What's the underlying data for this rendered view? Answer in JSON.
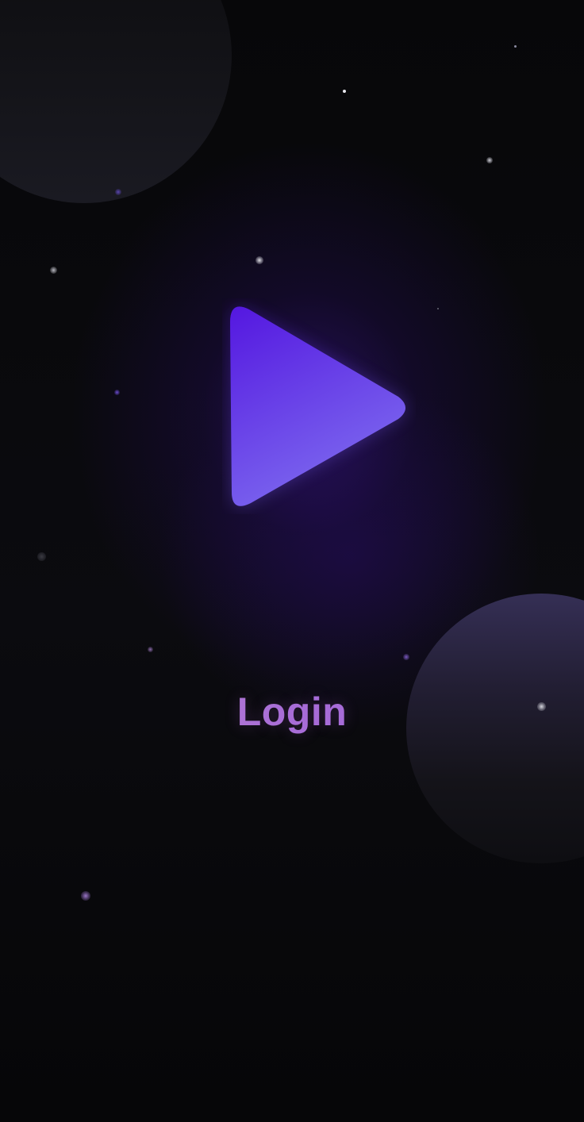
{
  "screen": {
    "background": "#050507"
  },
  "logo": {
    "icon": "play-icon",
    "gradient_start": "#5417e0",
    "gradient_end": "#7c68ef"
  },
  "login": {
    "label": "Login",
    "color_start": "#c48ec8",
    "color_end": "#9d62d6"
  }
}
